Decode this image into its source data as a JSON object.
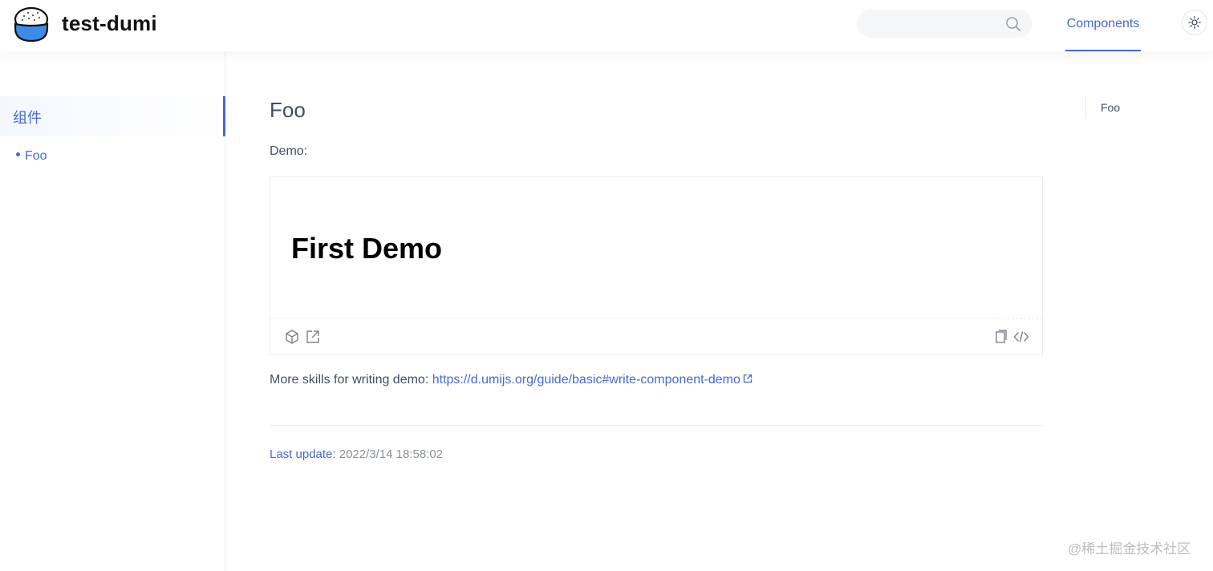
{
  "header": {
    "site_title": "test-dumi",
    "search": {
      "placeholder": "",
      "icon": "search-icon"
    },
    "nav": [
      {
        "label": "Components",
        "active": true
      }
    ],
    "theme_icon": "sun-icon"
  },
  "sidebar": {
    "group_label": "组件",
    "items": [
      {
        "label": "Foo",
        "active": true
      }
    ]
  },
  "main": {
    "title": "Foo",
    "demo_label": "Demo:",
    "demo": {
      "heading": "First Demo",
      "actions": [
        "codesandbox-icon",
        "open-external-icon",
        "copy-icon",
        "code-icon"
      ]
    },
    "more_text": "More skills for writing demo: ",
    "more_link": "https://d.umijs.org/guide/basic#write-component-demo",
    "last_update_label": "Last update:",
    "last_update_value": "2022/3/14 18:58:02"
  },
  "toc": {
    "items": [
      "Foo"
    ]
  },
  "watermark": "@稀土掘金技术社区",
  "colors": {
    "accent": "#4569d4",
    "text": "#454d64",
    "border": "#ebedf1"
  }
}
